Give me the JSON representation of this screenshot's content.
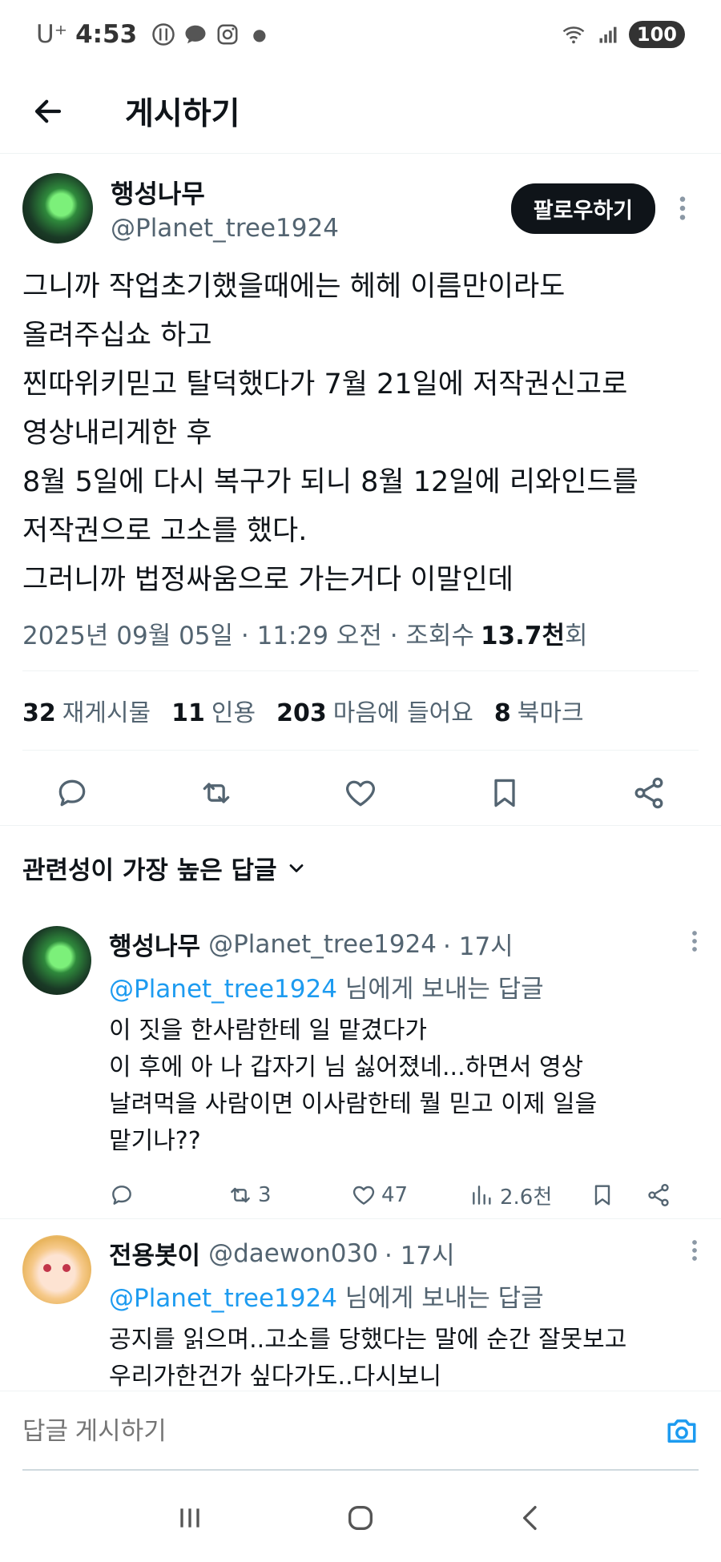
{
  "status": {
    "carrier": "U⁺",
    "time": "4:53",
    "battery": "100"
  },
  "header": {
    "title": "게시하기"
  },
  "tweet": {
    "author_name": "행성나무",
    "author_handle": "@Planet_tree1924",
    "follow_label": "팔로우하기",
    "body": "그니까 작업초기했을때에는 헤헤 이름만이라도\n올려주십쇼 하고\n찐따위키믿고 탈덕했다가 7월 21일에 저작권신고로\n영상내리게한 후\n8월 5일에 다시 복구가 되니  8월 12일에 리와인드를\n저작권으로 고소를 했다.\n그러니까 법정싸움으로 가는거다 이말인데",
    "meta_prefix": "2025년 09월 05일 · 11:29 오전 · 조회수",
    "views_num": "13.7천",
    "views_suffix": "회",
    "stats": {
      "reposts_num": "32",
      "reposts_label": "재게시물",
      "quotes_num": "11",
      "quotes_label": "인용",
      "likes_num": "203",
      "likes_label": "마음에 들어요",
      "bookmarks_num": "8",
      "bookmarks_label": "북마크"
    }
  },
  "replies_header": "관련성이 가장 높은 답글",
  "replies": [
    {
      "name": "행성나무",
      "handle": "@Planet_tree1924",
      "time": "· 17시",
      "reply_to_mention": "@Planet_tree1924",
      "reply_to_suffix": " 님에게 보내는 답글",
      "text": "이 짓을 한사람한테 일 맡겼다가\n이 후에 아 나 갑자기 님 싫어졌네...하면서  영상\n날려먹을 사람이면 이사람한테 뭘 믿고 이제 일을\n맡기나??",
      "retweets": "3",
      "likes": "47",
      "views": "2.6천"
    },
    {
      "name": "전용봇이",
      "handle": "@daewon030",
      "time": "· 17시",
      "reply_to_mention": "@Planet_tree1924",
      "reply_to_suffix": " 님에게 보내는 답글",
      "text": "공지를 읽으며..고소를 당했다는 말에 순간 잘못보고\n우리가한건가 싶다가도..다시보니"
    }
  ],
  "compose": {
    "placeholder": "답글 게시하기"
  },
  "icons": {
    "back": "arrow-left-icon",
    "more": "more-vertical-icon",
    "reply": "speech-bubble-icon",
    "repost": "repost-icon",
    "like": "heart-icon",
    "bookmark": "bookmark-icon",
    "share": "share-icon",
    "views": "bar-chart-icon",
    "camera": "camera-icon"
  },
  "colors": {
    "accent": "#1d9bf0",
    "text": "#0f1419",
    "muted": "#536471"
  }
}
